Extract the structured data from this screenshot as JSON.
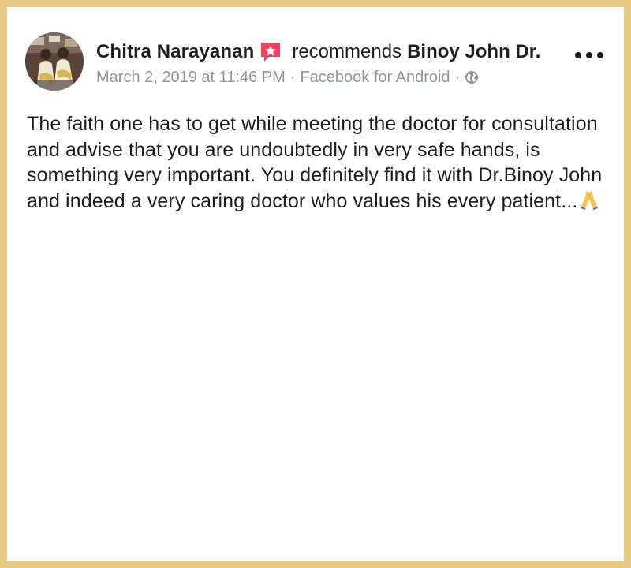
{
  "post": {
    "author": "Chitra Narayanan",
    "action": "recommends",
    "page": "Binoy John Dr.",
    "timestamp": "March 2, 2019 at 11:46 PM",
    "separator": "·",
    "source": "Facebook for Android",
    "privacy_icon": "globe-icon",
    "recommend_icon": "recommendation-star-icon",
    "body_text": "The faith one has to get while meeting the doctor for consultation and advise that you are undoubtedly in very safe hands, is something very important. You definitely find it with Dr.Binoy John and indeed a very caring doctor who values his every patient...",
    "body_emoji": "folded-hands-icon"
  },
  "colors": {
    "frame": "#e6c983",
    "card_background": "#ffffff",
    "primary_text": "#1c1e21",
    "secondary_text": "#90949c",
    "recommend_badge": "#f3425f"
  }
}
